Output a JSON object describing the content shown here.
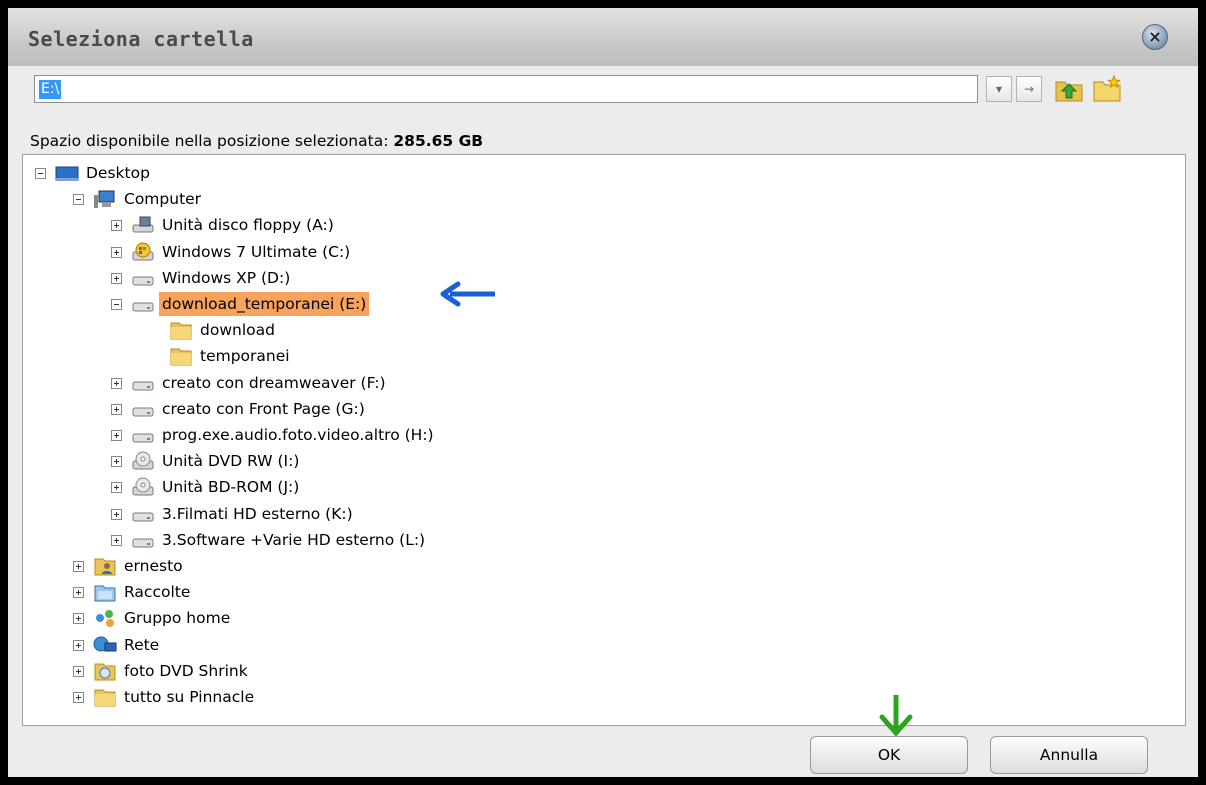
{
  "title": "Seleziona cartella",
  "path": {
    "value": "E:\\"
  },
  "toolbar": {
    "dropdown_glyph": "▾",
    "go_glyph": "→"
  },
  "space_info": {
    "label": "Spazio disponibile nella posizione selezionata:",
    "value": "285.65 GB"
  },
  "tree": {
    "desktop": "Desktop",
    "computer": "Computer",
    "drives": [
      "Unità disco floppy (A:)",
      "Windows 7 Ultimate (C:)",
      "Windows XP (D:)",
      "download_temporanei (E:)",
      "creato con dreamweaver (F:)",
      "creato con  Front Page (G:)",
      "prog.exe.audio.foto.video.altro (H:)",
      "Unità DVD RW (I:)",
      "Unità BD-ROM (J:)",
      "3.Filmati HD esterno (K:)",
      "3.Software +Varie HD esterno (L:)"
    ],
    "subfolders": [
      "download",
      "temporanei"
    ],
    "others": [
      "ernesto",
      "Raccolte",
      "Gruppo home",
      "Rete",
      "foto DVD Shrink",
      "tutto su Pinnacle"
    ]
  },
  "buttons": {
    "ok": "OK",
    "cancel": "Annulla"
  },
  "close_glyph": "×",
  "colors": {
    "selection": "#f7a35c",
    "annotation_arrow_blue": "#1a5fd6",
    "annotation_arrow_green": "#2ea31f",
    "path_highlight": "#3399ff"
  },
  "icons": {
    "desktop": "desktop-icon",
    "computer": "computer-icon",
    "floppy": "floppy-drive-icon",
    "windows_drive": "windows-drive-icon",
    "hard_drive": "hard-drive-icon",
    "dvd": "dvd-drive-icon",
    "folder": "folder-icon",
    "user": "user-folder-icon",
    "libraries": "libraries-icon",
    "homegroup": "homegroup-icon",
    "network": "network-icon",
    "photo": "photo-folder-icon",
    "up": "up-folder-icon",
    "new_folder": "new-folder-icon"
  }
}
